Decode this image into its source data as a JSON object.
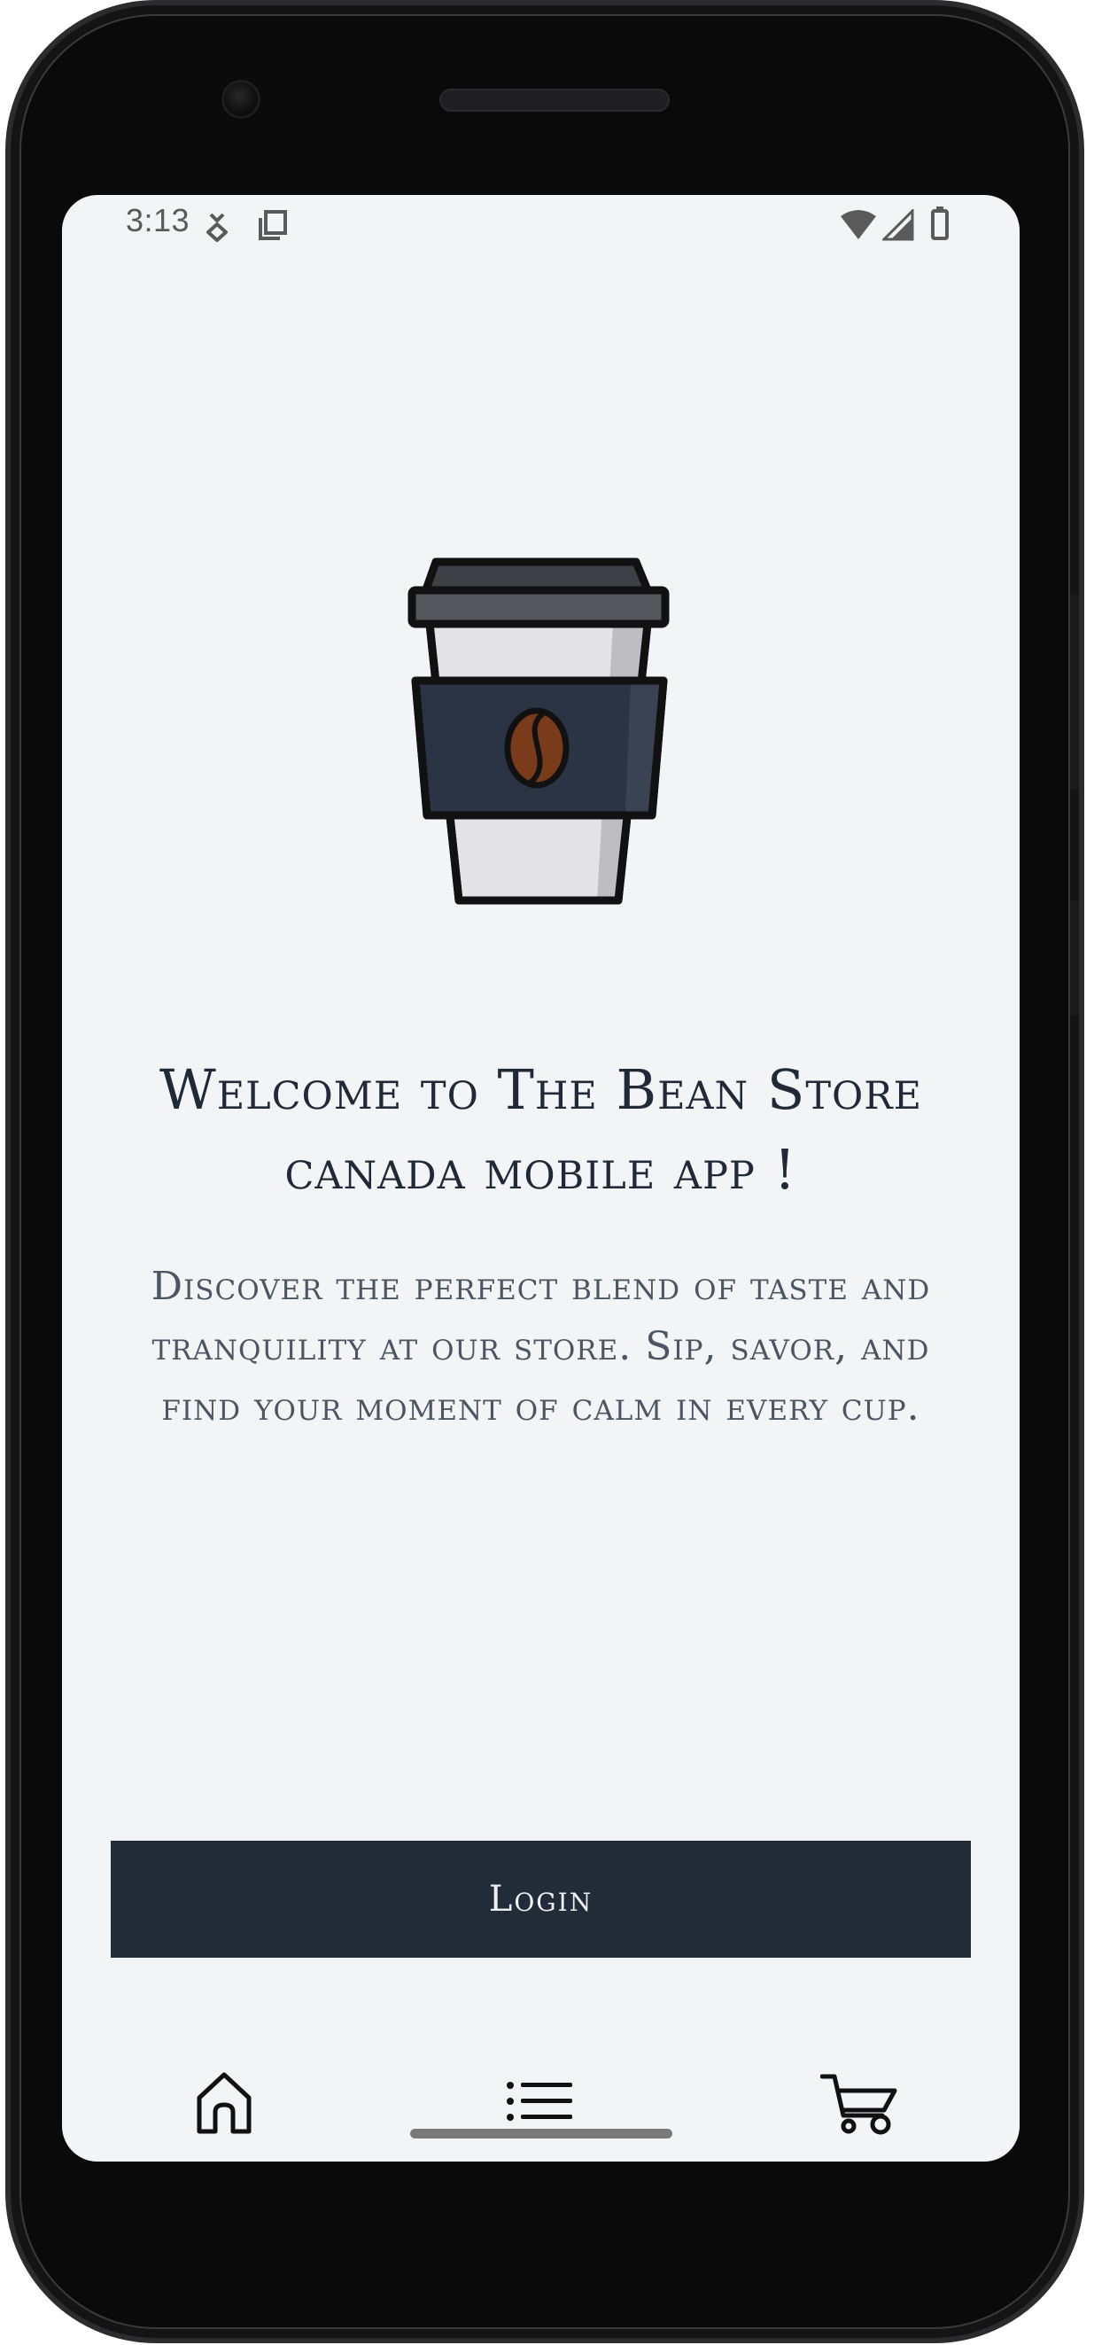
{
  "status_bar": {
    "time": "3:13",
    "icons": [
      "download-icon",
      "copy-icon",
      "wifi-icon",
      "signal-icon",
      "battery-icon"
    ]
  },
  "hero": {
    "image": "coffee-cup-icon",
    "headline": "Welcome to The Bean Store canada mobile app !",
    "tagline": "Discover the perfect blend of taste and tranquility at our store. Sip, savor, and find your moment of calm in every cup."
  },
  "actions": {
    "login_label": "Login"
  },
  "bottom_nav": {
    "items": [
      {
        "icon": "home-icon"
      },
      {
        "icon": "list-icon"
      },
      {
        "icon": "cart-icon"
      }
    ]
  },
  "colors": {
    "background": "#f3f4f6",
    "primary_dark": "#222b38",
    "text_dark": "#1f2937",
    "text_muted": "#4b5563",
    "bean_brown": "#7a3b1b"
  }
}
